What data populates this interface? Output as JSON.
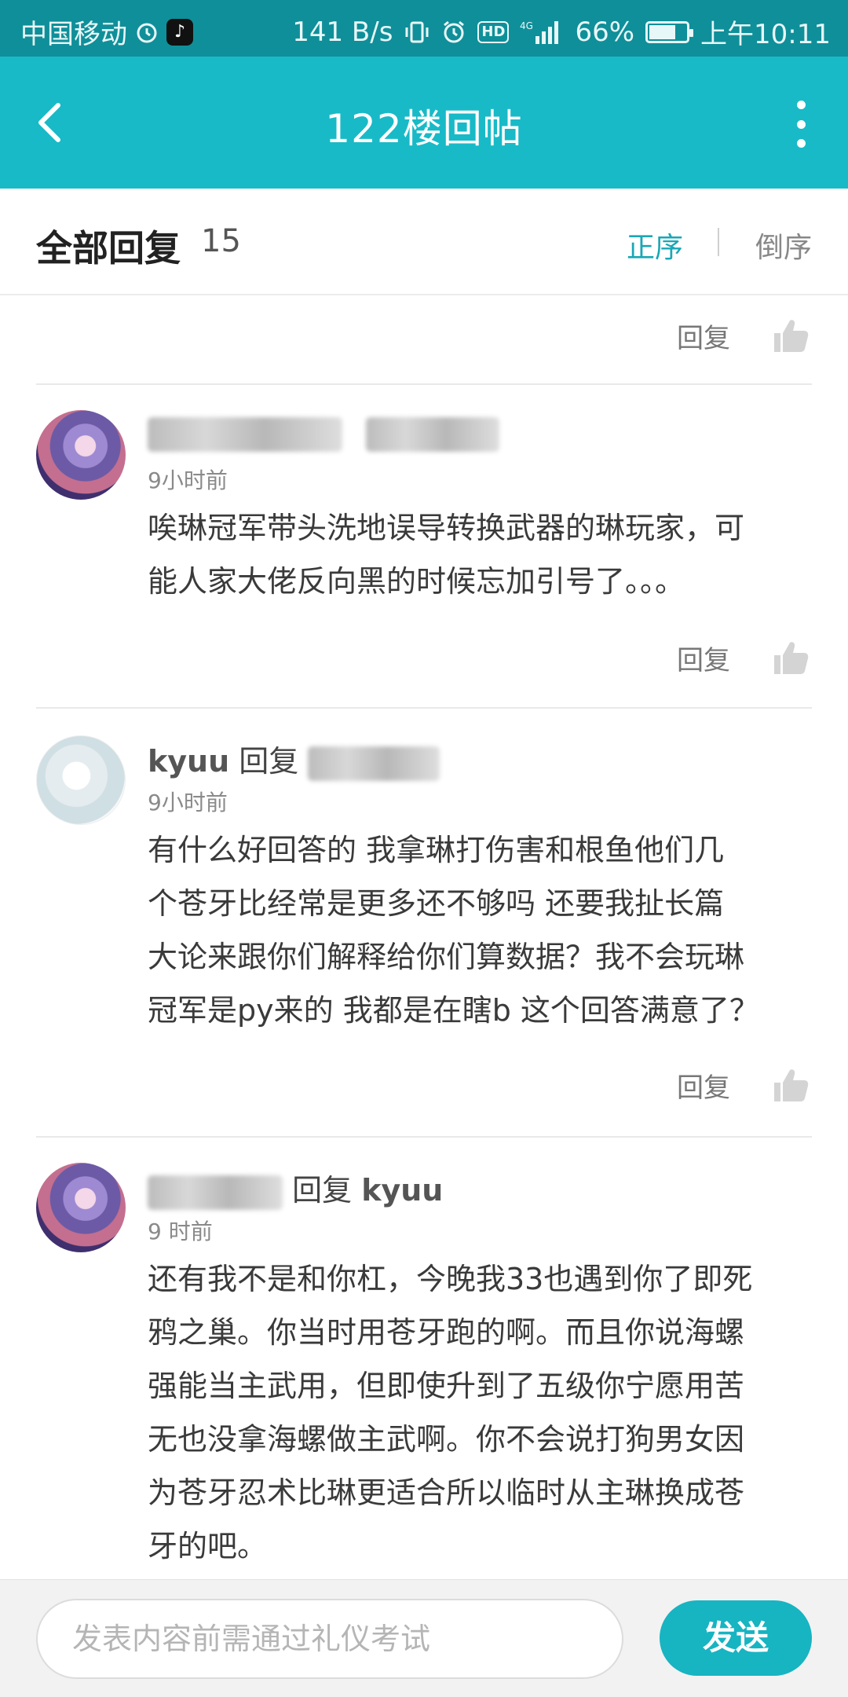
{
  "status_bar": {
    "carrier": "中国移动",
    "network_speed": "141 B/s",
    "network_type": "4G",
    "battery": "66%",
    "battery_level": 0.66,
    "time": "上午10:11",
    "hd_label": "HD",
    "icons": [
      "alarm-icon",
      "tiktok-icon",
      "vibrate-icon",
      "clock-icon",
      "signal-icon",
      "battery-icon"
    ]
  },
  "title_bar": {
    "title": "122楼回帖"
  },
  "reply_header": {
    "title": "全部回复",
    "count": "15",
    "sort_asc": "正序",
    "sort_desc": "倒序"
  },
  "colors": {
    "status_bar": "#0f8f99",
    "title_bar": "#18bac7",
    "accent": "#1aa7b5",
    "send_button": "#17b4c2"
  },
  "reply_label": "回复",
  "comments": [
    {
      "username": "",
      "reply_word": "",
      "reply_to": "",
      "time": "9小时前",
      "text_lines": [
        "唉琳冠军带头洗地误导转换武器的琳玩家，可",
        "能人家大佬反向黑的时候忘加引号了。。。"
      ]
    },
    {
      "username": "kyuu",
      "reply_word": "回复",
      "reply_to": "",
      "time": "9小时前",
      "text_lines": [
        "有什么好回答的 我拿琳打伤害和根鱼他们几",
        "个苍牙比经常是更多还不够吗 还要我扯长篇",
        "大论来跟你们解释给你们算数据？我不会玩琳",
        "冠军是py来的 我都是在瞎b 这个回答满意了？"
      ]
    },
    {
      "username": "",
      "reply_word": "回复",
      "reply_to": "kyuu",
      "time": "9 时前",
      "text_lines": [
        "还有我不是和你杠，今晚我33也遇到你了即死",
        "鸦之巢。你当时用苍牙跑的啊。而且你说海螺",
        "强能当主武用，但即使升到了五级你宁愿用苦",
        "无也没拿海螺做主武啊。你不会说打狗男女因",
        "为苍牙忍术比琳更适合所以临时从主琳换成苍",
        "牙的吧。"
      ]
    }
  ],
  "bottom_bar": {
    "input_placeholder": "发表内容前需通过礼仪考试",
    "send_label": "发送"
  }
}
